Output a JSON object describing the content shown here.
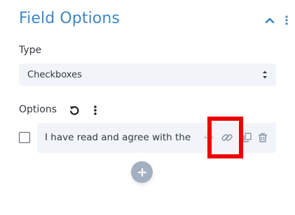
{
  "header": {
    "title": "Field Options",
    "collapse_icon": "chevron-up-icon",
    "menu_icon": "kebab-vertical-icon"
  },
  "type_field": {
    "label": "Type",
    "selected": "Checkboxes"
  },
  "options_section": {
    "label": "Options",
    "reset_icon": "reset-icon",
    "menu_icon": "kebab-vertical-icon",
    "items": [
      {
        "text": "I have read and agree with the",
        "checked": false,
        "icons": [
          "move-icon",
          "link-icon",
          "copy-icon",
          "trash-icon"
        ]
      }
    ],
    "add_icon": "plus-icon"
  },
  "colors": {
    "accent": "#3d87c5",
    "text": "#333a44",
    "field_bg": "#f1f5f9",
    "icon_gray": "#8a97a8",
    "highlight": "#ee0000",
    "add_button": "#a2b0c2"
  }
}
